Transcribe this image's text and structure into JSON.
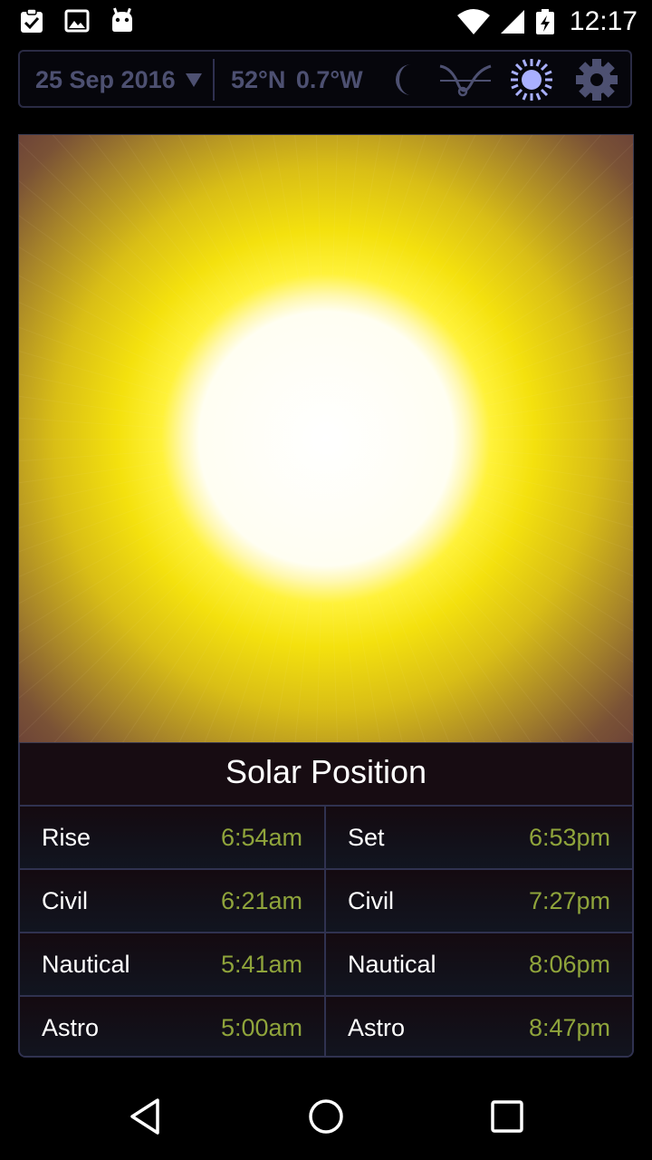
{
  "status_bar": {
    "left_icons": [
      "clipboard-check-icon",
      "image-icon",
      "android-icon"
    ],
    "right_icons": [
      "wifi-icon",
      "cell-signal-icon",
      "battery-charging-icon"
    ],
    "time": "12:17"
  },
  "toolbar": {
    "date": "25 Sep 2016",
    "latitude": "52°N",
    "longitude": "0.7°W",
    "buttons": [
      "moon-icon",
      "curve-chart-icon",
      "sun-icon",
      "gear-icon"
    ],
    "accent_color": "#4d5071",
    "active_color": "#a9b0ff"
  },
  "solar_position": {
    "title": "Solar Position",
    "rows": [
      {
        "left_label": "Rise",
        "left_value": "6:54am",
        "right_label": "Set",
        "right_value": "6:53pm"
      },
      {
        "left_label": "Civil",
        "left_value": "6:21am",
        "right_label": "Civil",
        "right_value": "7:27pm"
      },
      {
        "left_label": "Nautical",
        "left_value": "5:41am",
        "right_label": "Nautical",
        "right_value": "8:06pm"
      },
      {
        "left_label": "Astro",
        "left_value": "5:00am",
        "right_label": "Astro",
        "right_value": "8:47pm"
      }
    ],
    "value_color": "#8fa43b"
  },
  "nav_bar": {
    "buttons": [
      "back-icon",
      "home-icon",
      "recents-icon"
    ]
  }
}
